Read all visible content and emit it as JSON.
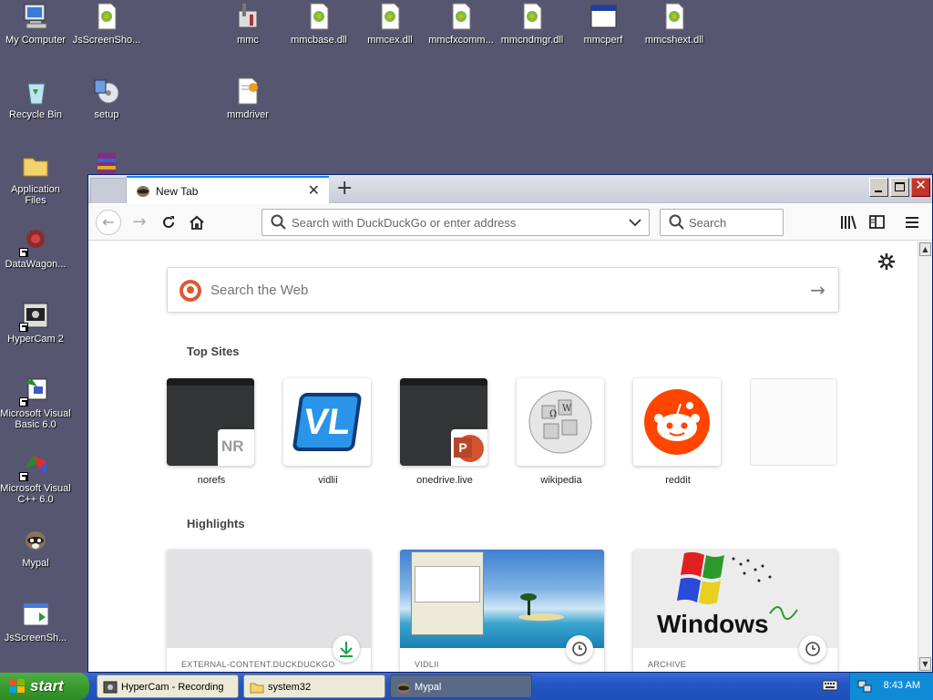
{
  "desktop": {
    "icons": [
      {
        "label": "My Computer"
      },
      {
        "label": "JsScreenSho..."
      },
      {
        "label": "mmc"
      },
      {
        "label": "mmcbase.dll"
      },
      {
        "label": "mmcex.dll"
      },
      {
        "label": "mmcfxcomm..."
      },
      {
        "label": "mmcndmgr.dll"
      },
      {
        "label": "mmcperf"
      },
      {
        "label": "mmcshext.dll"
      },
      {
        "label": "Recycle Bin"
      },
      {
        "label": "setup"
      },
      {
        "label": "mmdriver"
      },
      {
        "label": "Application Files"
      },
      {
        "label": "DataWagon..."
      },
      {
        "label": "HyperCam 2"
      },
      {
        "label": "Microsoft Visual Basic 6.0"
      },
      {
        "label": "Microsoft Visual C++ 6.0"
      },
      {
        "label": "Mypal"
      },
      {
        "label": "JsScreenSh..."
      }
    ]
  },
  "browser": {
    "tab": {
      "title": "New Tab",
      "close": "✕"
    },
    "new_tab": "+",
    "url_placeholder": "Search with DuckDuckGo or enter address",
    "search_placeholder": "Search",
    "web_search_placeholder": "Search the Web",
    "top_sites_title": "Top Sites",
    "top_sites": [
      {
        "name": "norefs",
        "badge": "NR"
      },
      {
        "name": "vidlii",
        "logo": "VL"
      },
      {
        "name": "onedrive.live",
        "badge": "P"
      },
      {
        "name": "wikipedia"
      },
      {
        "name": "reddit"
      },
      {
        "name": ""
      }
    ],
    "highlights_title": "Highlights",
    "highlights": [
      {
        "source": "EXTERNAL-CONTENT.DUCKDUCKGO — I...",
        "icon": "download-icon"
      },
      {
        "source": "VIDLII",
        "icon": "clock-icon"
      },
      {
        "source": "ARCHIVE",
        "icon": "clock-icon",
        "image_text": "Windows"
      }
    ],
    "accent": "#0a84ff"
  },
  "taskbar": {
    "start_label": "start",
    "tasks": [
      {
        "label": "HyperCam - Recording"
      },
      {
        "label": "system32"
      },
      {
        "label": "Mypal"
      }
    ],
    "clock": "8:43 AM"
  }
}
